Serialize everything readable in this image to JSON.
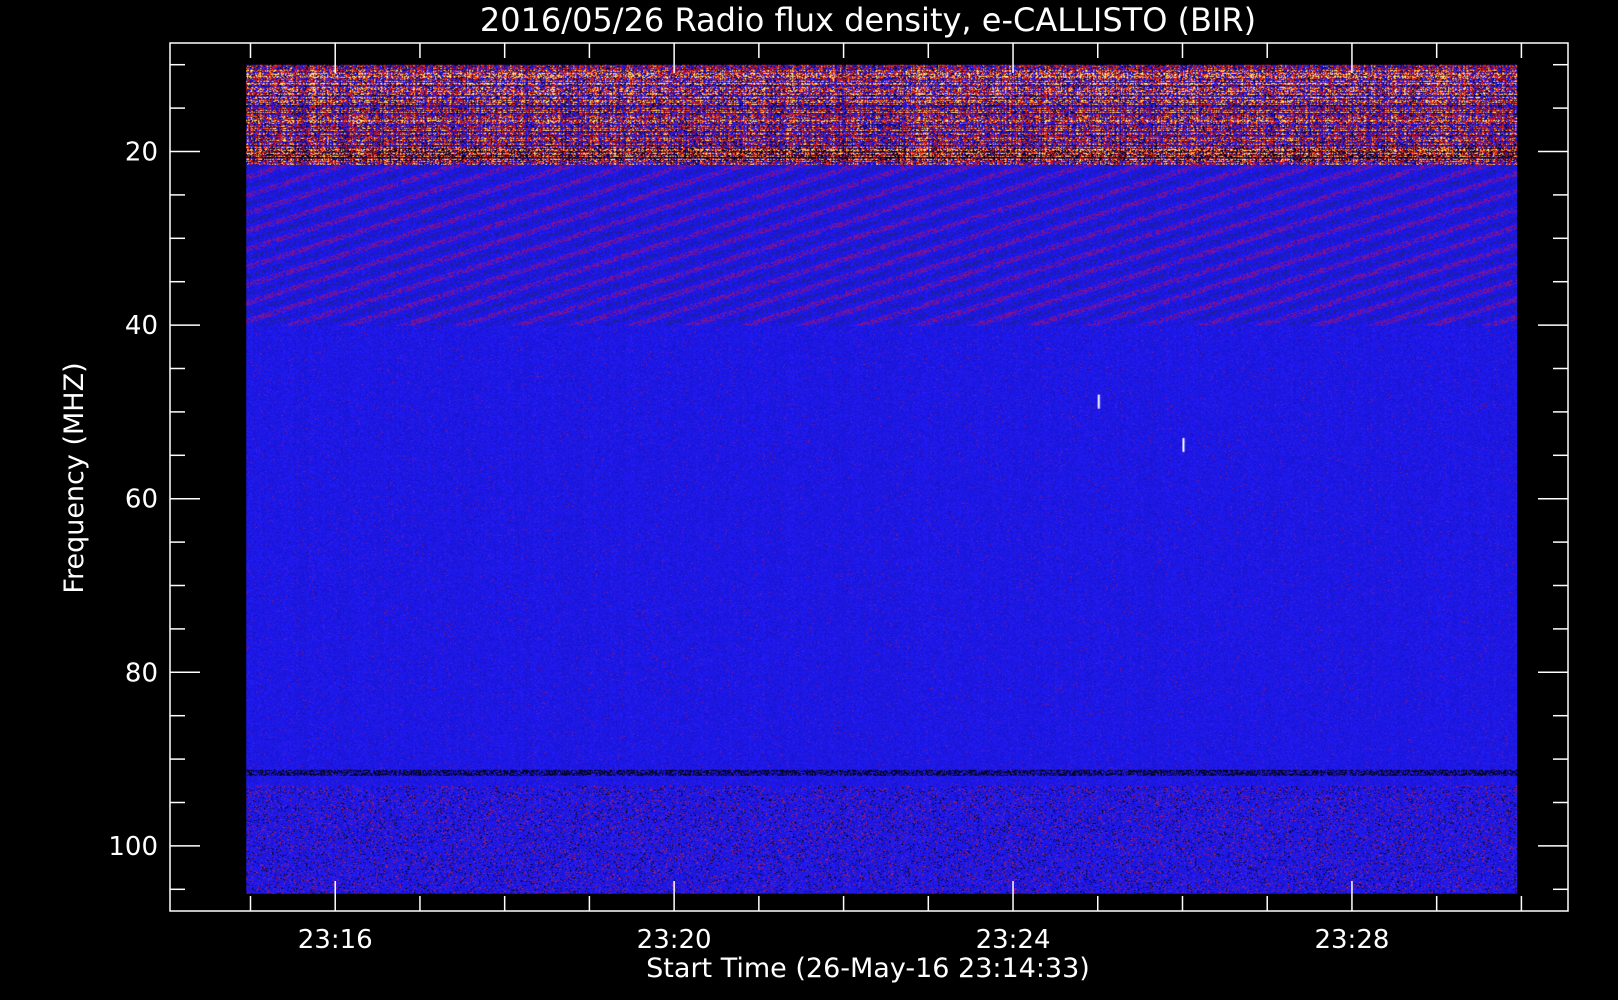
{
  "chart_data": {
    "type": "heatmap",
    "title": "2016/05/26  Radio flux density, e-CALLISTO (BIR)",
    "xlabel": "Start Time (26-May-16 23:14:33)",
    "ylabel": "Frequency (MHZ)",
    "x_major_ticks": [
      "23:16",
      "23:20",
      "23:24",
      "23:28"
    ],
    "y_major_ticks": [
      20,
      40,
      60,
      80,
      100
    ],
    "xlim_minutes": [
      -1.95,
      14.55
    ],
    "ylim": [
      107.5,
      7.5
    ],
    "x_data_range_minutes": [
      -1.05,
      13.95
    ],
    "y_data_range": [
      10,
      105.5
    ],
    "x_minor_step_minutes": 1,
    "y_minor_step": 5,
    "colors": {
      "background": "#000000",
      "axes": "#ffffff",
      "quiet_sky": "#1a16f0",
      "dark_band": "#06052a",
      "emission_red": "#d41818",
      "emission_orange": "#ff7a10",
      "emission_yellow": "#ffe070"
    },
    "features": [
      {
        "kind": "band",
        "freq": [
          10,
          21.5
        ],
        "level": "intense, broadband RFI"
      },
      {
        "kind": "band",
        "freq": [
          22,
          40
        ],
        "level": "diagonal striations"
      },
      {
        "kind": "line",
        "freq": 91.5,
        "level": "dark horizontal line"
      },
      {
        "kind": "band",
        "freq": [
          93,
          105.5
        ],
        "level": "speckled lower band"
      },
      {
        "kind": "spot",
        "time": "23:25:30",
        "freq": 48,
        "level": "white spike"
      },
      {
        "kind": "spot",
        "time": "23:26:30",
        "freq": 53,
        "level": "white spike"
      }
    ]
  }
}
